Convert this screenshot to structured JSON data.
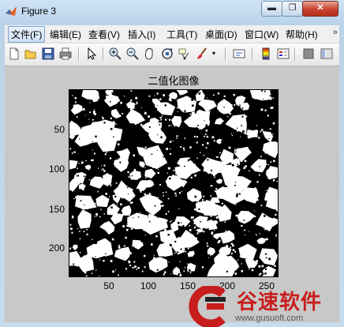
{
  "window": {
    "title": "Figure 3",
    "min_label": "▬",
    "max_label": "❐",
    "close_label": "✕"
  },
  "menu": {
    "items": [
      "文件(F)",
      "编辑(E)",
      "查看(V)",
      "插入(I)",
      "工具(T)",
      "桌面(D)",
      "窗口(W)",
      "帮助(H)"
    ],
    "active_index": 0,
    "more": "»"
  },
  "toolbar": {
    "icons": [
      "new-figure-icon",
      "open-file-icon",
      "save-icon",
      "print-icon",
      "pointer-icon",
      "zoom-in-icon",
      "zoom-out-icon",
      "pan-icon",
      "rotate-3d-icon",
      "data-cursor-icon",
      "brush-icon",
      "link-plot-icon",
      "colorbar-icon",
      "legend-icon",
      "hide-plot-tools-icon",
      "show-plot-tools-icon"
    ]
  },
  "figure": {
    "title": "二值化图像",
    "yticks": [
      "50",
      "100",
      "150",
      "200"
    ],
    "xticks": [
      "50",
      "100",
      "150",
      "200",
      "250"
    ],
    "colors": {
      "foreground": "#ffffff",
      "background": "#000000",
      "figure_bg": "#c8c8c8"
    }
  },
  "watermark": {
    "brand": "谷速软件",
    "url": "www.gusuoft.com",
    "color": "#c81d1d"
  }
}
